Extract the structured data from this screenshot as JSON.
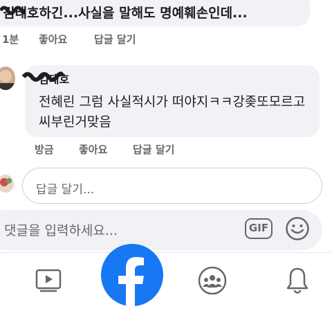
{
  "comment1": {
    "text": "김태호하긴...사실을 말해도 명예훼손인데...",
    "time": "1분",
    "like_label": "좋아요",
    "reply_label": "답글 달기"
  },
  "comment2": {
    "name": "김태호",
    "text": "전혜린 그럼 사실적시가 떠야지ㅋㅋ강좆또모르고씨부린거맞음",
    "time": "방금",
    "like_label": "좋아요",
    "reply_label": "답글 달기"
  },
  "reply_input": {
    "placeholder": "답글 달기..."
  },
  "compose": {
    "placeholder": "댓글을 입력하세요...",
    "gif_label": "GIF"
  },
  "nav": {
    "icons": [
      "watch-icon",
      "facebook-logo-icon",
      "groups-icon",
      "notifications-icon"
    ],
    "brand_color": "#1877f2"
  }
}
